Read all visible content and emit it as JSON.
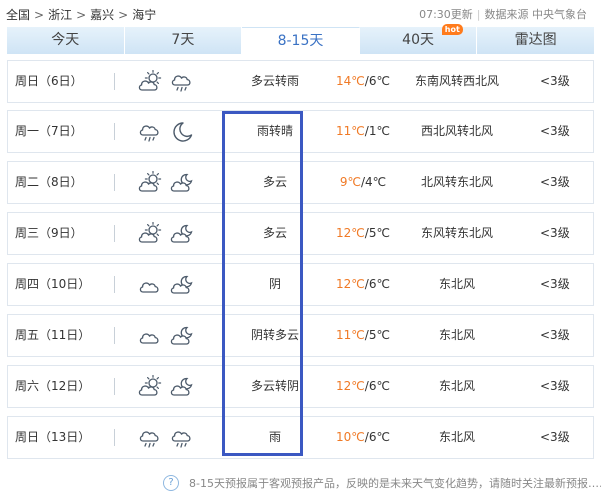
{
  "breadcrumb": {
    "items": [
      "全国",
      "浙江",
      "嘉兴",
      "海宁"
    ],
    "separator": ">"
  },
  "meta": {
    "update": "07:30更新",
    "source": "数据来源 中央气象台"
  },
  "tabs": [
    {
      "label": "今天",
      "active": false
    },
    {
      "label": "7天",
      "active": false
    },
    {
      "label": "8-15天",
      "active": true
    },
    {
      "label": "40天",
      "active": false,
      "badge": "hot"
    },
    {
      "label": "雷达图",
      "active": false
    }
  ],
  "colors": {
    "tab_active": "#3a72c4",
    "temp_high": "#f07a26",
    "highlight_border": "#3b58c2",
    "hot_badge": "#ff7b1c"
  },
  "forecast": [
    {
      "date": "周日（6日）",
      "icons": [
        "partly-cloudy-day-icon",
        "rain-icon"
      ],
      "condition": "多云转雨",
      "high": "14℃",
      "low": "6℃",
      "wind": "东南风转西北风",
      "level": "<3级"
    },
    {
      "date": "周一（7日）",
      "icons": [
        "rain-icon",
        "moon-icon"
      ],
      "condition": "雨转晴",
      "high": "11℃",
      "low": "1℃",
      "wind": "西北风转北风",
      "level": "<3级"
    },
    {
      "date": "周二（8日）",
      "icons": [
        "partly-cloudy-day-icon",
        "partly-cloudy-night-icon"
      ],
      "condition": "多云",
      "high": "9℃",
      "low": "4℃",
      "wind": "北风转东北风",
      "level": "<3级"
    },
    {
      "date": "周三（9日）",
      "icons": [
        "partly-cloudy-day-icon",
        "partly-cloudy-night-icon"
      ],
      "condition": "多云",
      "high": "12℃",
      "low": "5℃",
      "wind": "东风转东北风",
      "level": "<3级"
    },
    {
      "date": "周四（10日）",
      "icons": [
        "cloud-icon",
        "partly-cloudy-night-icon"
      ],
      "condition": "阴",
      "high": "12℃",
      "low": "6℃",
      "wind": "东北风",
      "level": "<3级"
    },
    {
      "date": "周五（11日）",
      "icons": [
        "cloud-icon",
        "partly-cloudy-night-icon"
      ],
      "condition": "阴转多云",
      "high": "11℃",
      "low": "5℃",
      "wind": "东北风",
      "level": "<3级"
    },
    {
      "date": "周六（12日）",
      "icons": [
        "partly-cloudy-day-icon",
        "partly-cloudy-night-icon"
      ],
      "condition": "多云转阴",
      "high": "12℃",
      "low": "6℃",
      "wind": "东北风",
      "level": "<3级"
    },
    {
      "date": "周日（13日）",
      "icons": [
        "rain-icon",
        "rain-icon"
      ],
      "condition": "雨",
      "high": "10℃",
      "low": "6℃",
      "wind": "东北风",
      "level": "<3级"
    }
  ],
  "footnote": {
    "icon": "question-icon",
    "text": "8-15天预报属于客观预报产品，反映的是未来天气变化趋势，请随时关注最新预报……"
  }
}
